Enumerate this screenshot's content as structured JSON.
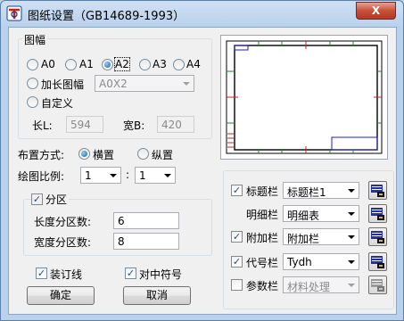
{
  "window": {
    "title": "图纸设置（GB14689-1993）",
    "close_label": "X"
  },
  "paper_size": {
    "group_title": "图幅",
    "options": [
      "A0",
      "A1",
      "A2",
      "A3",
      "A4"
    ],
    "selected": "A2",
    "extended_label": "加长图幅",
    "extended_value": "A0X2",
    "custom_label": "自定义",
    "length_label": "长L:",
    "length_value": "594",
    "width_label": "宽B:",
    "width_value": "420"
  },
  "layout": {
    "label": "布置方式:",
    "horizontal_label": "横置",
    "vertical_label": "纵置",
    "selected": "横置"
  },
  "scale": {
    "label": "绘图比例:",
    "left_value": "1",
    "separator": ":",
    "right_value": "1"
  },
  "zones": {
    "checkbox_label": "分区",
    "checked": true,
    "length_label": "长度分区数:",
    "length_value": "6",
    "width_label": "宽度分区数:",
    "width_value": "8"
  },
  "options": {
    "binding_line_label": "装订线",
    "binding_line_checked": true,
    "center_mark_label": "对中符号",
    "center_mark_checked": true
  },
  "buttons": {
    "ok": "确定",
    "cancel": "取消"
  },
  "blocks": [
    {
      "label": "标题栏",
      "has_checkbox": true,
      "checked": true,
      "value": "标题栏1",
      "enabled": true
    },
    {
      "label": "明细栏",
      "has_checkbox": false,
      "checked": false,
      "value": "明细表",
      "enabled": true
    },
    {
      "label": "附加栏",
      "has_checkbox": true,
      "checked": true,
      "value": "附加栏",
      "enabled": true
    },
    {
      "label": "代号栏",
      "has_checkbox": true,
      "checked": true,
      "value": "Tydh",
      "enabled": true
    },
    {
      "label": "参数栏",
      "has_checkbox": true,
      "checked": false,
      "value": "材料处理",
      "enabled": false
    }
  ],
  "icons": {
    "block_settings": "edit-table-icon",
    "app": "app-logo-icon"
  },
  "colors": {
    "preview_accent_blue": "#1d1dd0",
    "preview_mark_red": "#d02020",
    "preview_mark_green": "#1a8a1a"
  }
}
